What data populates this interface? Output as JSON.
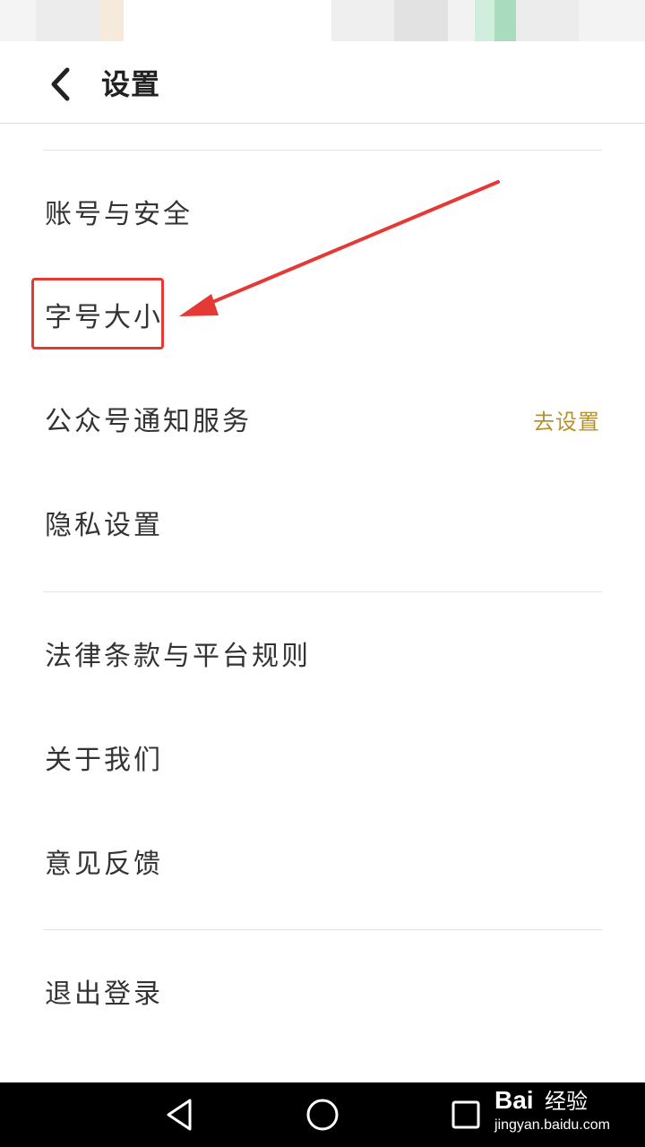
{
  "header": {
    "title": "设置",
    "back_icon": "chevron-left-icon"
  },
  "settings": {
    "group1": [
      {
        "label": "账号与安全"
      },
      {
        "label": "字号大小"
      },
      {
        "label": "公众号通知服务",
        "action": "去设置"
      },
      {
        "label": "隐私设置"
      }
    ],
    "group2": [
      {
        "label": "法律条款与平台规则"
      },
      {
        "label": "关于我们"
      },
      {
        "label": "意见反馈"
      }
    ],
    "group3": [
      {
        "label": "退出登录"
      }
    ]
  },
  "nav": {
    "back_icon": "triangle-back-icon",
    "home_icon": "circle-home-icon",
    "recents_icon": "square-recents-icon"
  },
  "watermark": {
    "brand": "Bai",
    "sub": "经验",
    "url": "jingyan.baidu.com"
  },
  "colors": {
    "action_text": "#b5922f",
    "annotation": "#e53935",
    "divider": "#e3e3e3"
  }
}
